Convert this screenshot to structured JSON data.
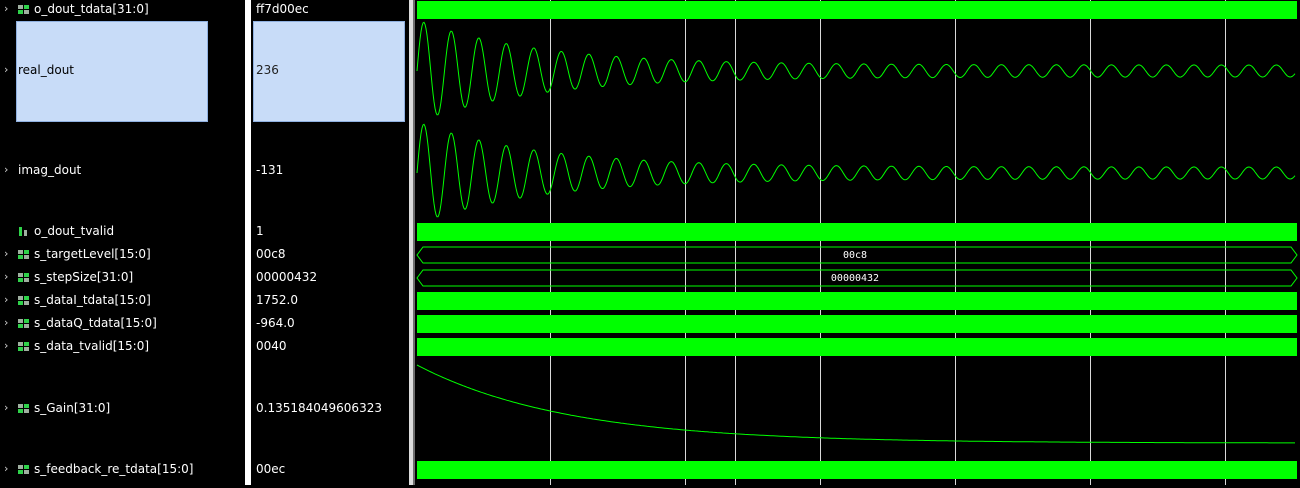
{
  "signals": [
    {
      "name": "o_dout_tdata[31:0]",
      "value": "ff7d00ec",
      "expand": true,
      "icon": "bus-icon",
      "wave": "bus-solid"
    },
    {
      "name": "real_dout",
      "value": "236",
      "expand": true,
      "icon": "",
      "wave": "analog",
      "selected": true
    },
    {
      "name": "imag_dout",
      "value": "-131",
      "expand": true,
      "icon": "",
      "wave": "analog"
    },
    {
      "name": "o_dout_tvalid",
      "value": "1",
      "expand": false,
      "icon": "bit-icon",
      "wave": "bit-high"
    },
    {
      "name": "s_targetLevel[15:0]",
      "value": "00c8",
      "expand": true,
      "icon": "bus-icon",
      "wave": "bus-hex",
      "wave_label": "00c8"
    },
    {
      "name": "s_stepSize[31:0]",
      "value": "00000432",
      "expand": true,
      "icon": "bus-icon",
      "wave": "bus-hex",
      "wave_label": "00000432"
    },
    {
      "name": "s_dataI_tdata[15:0]",
      "value": "1752.0",
      "expand": true,
      "icon": "bus-icon",
      "wave": "bus-solid"
    },
    {
      "name": "s_dataQ_tdata[15:0]",
      "value": "-964.0",
      "expand": true,
      "icon": "bus-icon",
      "wave": "bus-solid"
    },
    {
      "name": "s_data_tvalid[15:0]",
      "value": "0040",
      "expand": true,
      "icon": "bus-icon",
      "wave": "bus-solid"
    },
    {
      "name": "s_Gain[31:0]",
      "value": "0.135184049606323",
      "expand": true,
      "icon": "bus-icon",
      "wave": "analog-decay"
    },
    {
      "name": "s_feedback_re_tdata[15:0]",
      "value": "00ec",
      "expand": true,
      "icon": "bus-icon",
      "wave": "bus-solid"
    }
  ],
  "colors": {
    "wave": "#00ff00",
    "cursor": "#ffffff",
    "grid": "#ffffff",
    "background": "#000000"
  }
}
